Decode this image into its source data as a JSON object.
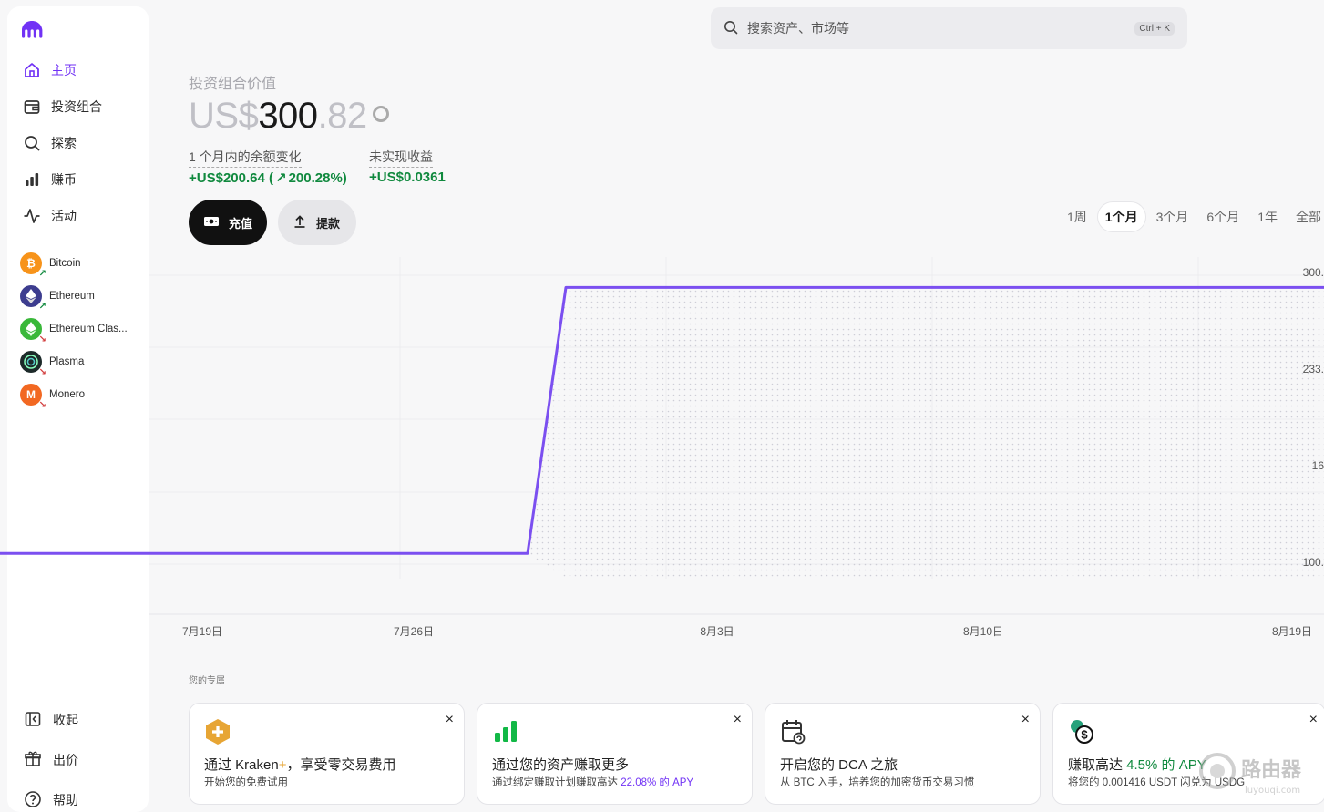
{
  "sidebar": {
    "nav": [
      {
        "label": "主页",
        "icon": "home-icon",
        "active": true
      },
      {
        "label": "投资组合",
        "icon": "wallet-icon",
        "active": false
      },
      {
        "label": "探索",
        "icon": "search-icon",
        "active": false
      },
      {
        "label": "赚币",
        "icon": "bar-chart-icon",
        "active": false
      },
      {
        "label": "活动",
        "icon": "activity-icon",
        "active": false
      }
    ],
    "coins": [
      {
        "name": "Bitcoin",
        "trend": "up",
        "color": "#f7931a"
      },
      {
        "name": "Ethereum",
        "trend": "up",
        "color": "#3d3d8f"
      },
      {
        "name": "Ethereum Clas...",
        "trend": "down",
        "color": "#3ab83a"
      },
      {
        "name": "Plasma",
        "trend": "down",
        "color": "#1d2a2a"
      },
      {
        "name": "Monero",
        "trend": "down",
        "color": "#f26822"
      }
    ],
    "bottom": [
      {
        "label": "收起",
        "icon": "collapse-icon"
      },
      {
        "label": "出价",
        "icon": "gift-icon"
      },
      {
        "label": "帮助",
        "icon": "help-icon"
      }
    ]
  },
  "search": {
    "placeholder": "搜索资产、市场等",
    "shortcut": "Ctrl + K"
  },
  "portfolio": {
    "label": "投资组合价值",
    "value_prefix": "US$",
    "value_int": "300",
    "value_dec": ".82",
    "change_label": "1 个月内的余额变化",
    "change_value": "+US$200.64 (",
    "change_pct": "200.28%)",
    "unrealized_label": "未实现收益",
    "unrealized_value": "+US$0.0361"
  },
  "actions": {
    "deposit": "充值",
    "withdraw": "提款"
  },
  "ranges": [
    "1周",
    "1个月",
    "3个月",
    "6个月",
    "1年",
    "全部"
  ],
  "selected_range": "1个月",
  "chart_data": {
    "type": "line",
    "x": [
      "7月15日",
      "7月30日",
      "7月31日",
      "8月20日"
    ],
    "values": [
      100.18,
      100.18,
      300.82,
      300.82
    ],
    "xticks": [
      "7月19日",
      "7月26日",
      "8月3日",
      "8月10日",
      "8月19日"
    ],
    "yticks": [
      "300.",
      "233.",
      "16",
      "100."
    ],
    "ylim": [
      90,
      310
    ],
    "series_color": "#7b4ff0"
  },
  "section_title": "您的专属",
  "cards": [
    {
      "title_a": "通过 Kraken",
      "title_plus": "+",
      "title_b": "，享受零交易费用",
      "sub_a": "开始您的免费试用",
      "sub_b": ""
    },
    {
      "title_a": "通过您的资产赚取更多",
      "title_plus": "",
      "title_b": "",
      "sub_a": "通过绑定赚取计划赚取高达 ",
      "sub_b": "22.08% 的 APY"
    },
    {
      "title_a": "开启您的 DCA 之旅",
      "title_plus": "",
      "title_b": "",
      "sub_a": "从 BTC 入手，培养您的加密货币交易习惯",
      "sub_b": ""
    },
    {
      "title_a": "赚取高达 ",
      "title_plus": "4.5% 的 APY",
      "title_b": "",
      "sub_a": "将您的 0.001416 USDT 闪兑为 USDG",
      "sub_b": ""
    }
  ],
  "close_glyph": "×",
  "watermark": "路由器",
  "watermark_sub": "luyouqi.com"
}
